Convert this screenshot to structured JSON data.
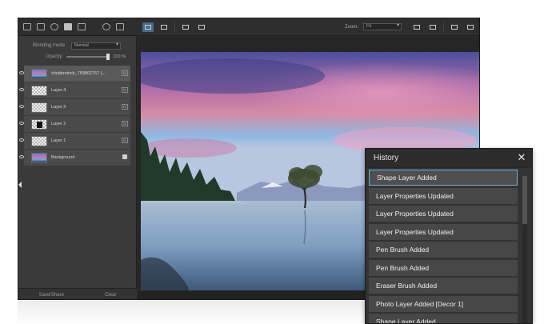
{
  "layers_panel": {
    "blending_label": "Blending mode",
    "blending_value": "Normal",
    "opacity_label": "Opacity",
    "opacity_value": "100 %",
    "opacity_fraction": 1.0,
    "layers": [
      {
        "name": "shutterstock_759862767 (...",
        "thumb": "photo",
        "trailing": "fx",
        "selected": true
      },
      {
        "name": "Layer 4",
        "thumb": "checker",
        "trailing": "fx",
        "selected": false
      },
      {
        "name": "Layer 3",
        "thumb": "checker",
        "trailing": "fx",
        "selected": false
      },
      {
        "name": "Layer 2",
        "thumb": "shape",
        "trailing": "fx",
        "selected": false
      },
      {
        "name": "Layer 1",
        "thumb": "checker",
        "trailing": "fx",
        "selected": false
      },
      {
        "name": "Background",
        "thumb": "photo",
        "trailing": "lock",
        "selected": false
      }
    ],
    "fx_label": "fx",
    "footer": {
      "save_share": "Save/Share",
      "clear": "Clear"
    }
  },
  "canvas_toolbar": {
    "zoom_label": "Zoom:",
    "zoom_value": "Fit"
  },
  "history": {
    "title": "History",
    "close_glyph": "✕",
    "items": [
      "Shape Layer Added",
      "Layer Properties Updated",
      "Layer Properties Updated",
      "Layer Properties Updated",
      "Pen Brush Added",
      "Pen Brush Added",
      "Eraser Brush Added",
      "Photo Layer Added [Decor 1]",
      "Shape Layer Added"
    ],
    "selected_index": 0
  },
  "colors": {
    "accent": "#6fb3e0",
    "panel_bg": "#3a3a3a",
    "history_item_bg": "#474747"
  }
}
